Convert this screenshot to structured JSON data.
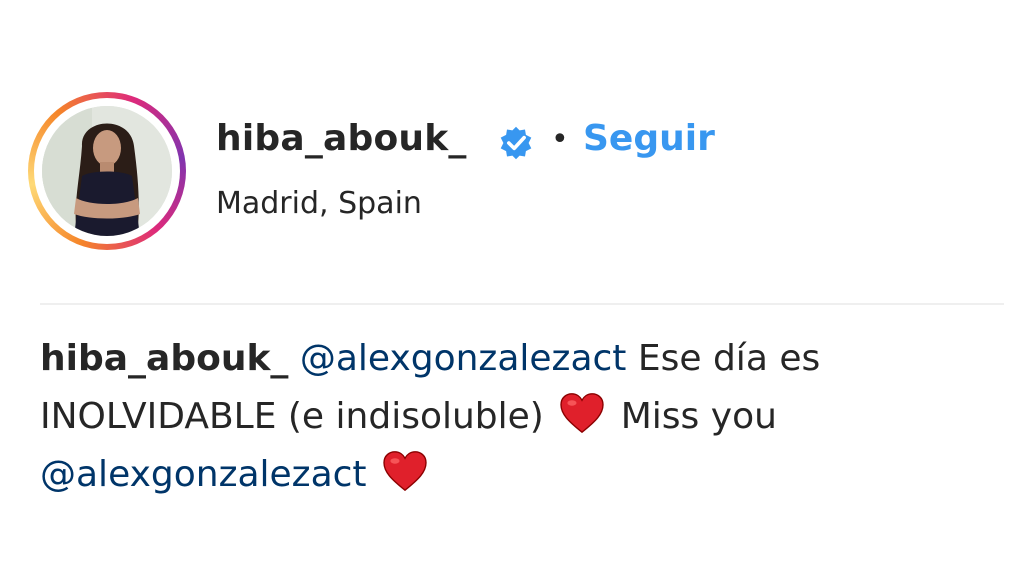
{
  "post_header": {
    "username": "hiba_abouk_",
    "verified_icon": "verified-badge-icon",
    "separator": "•",
    "follow_label": "Seguir",
    "location": "Madrid, Spain"
  },
  "caption": {
    "author": "hiba_abouk_",
    "mention_1": "@alexgonzalezact",
    "text_1": " Ese día es INOLVIDABLE (e indisoluble) ",
    "emoji_1": "heart-icon",
    "text_2": " Miss you ",
    "mention_2": "@alexgonzalezact",
    "emoji_2": "heart-icon"
  },
  "colors": {
    "link_blue": "#3897f0",
    "mention_blue": "#003569",
    "text": "#262626",
    "heart_red": "#e0202b"
  }
}
